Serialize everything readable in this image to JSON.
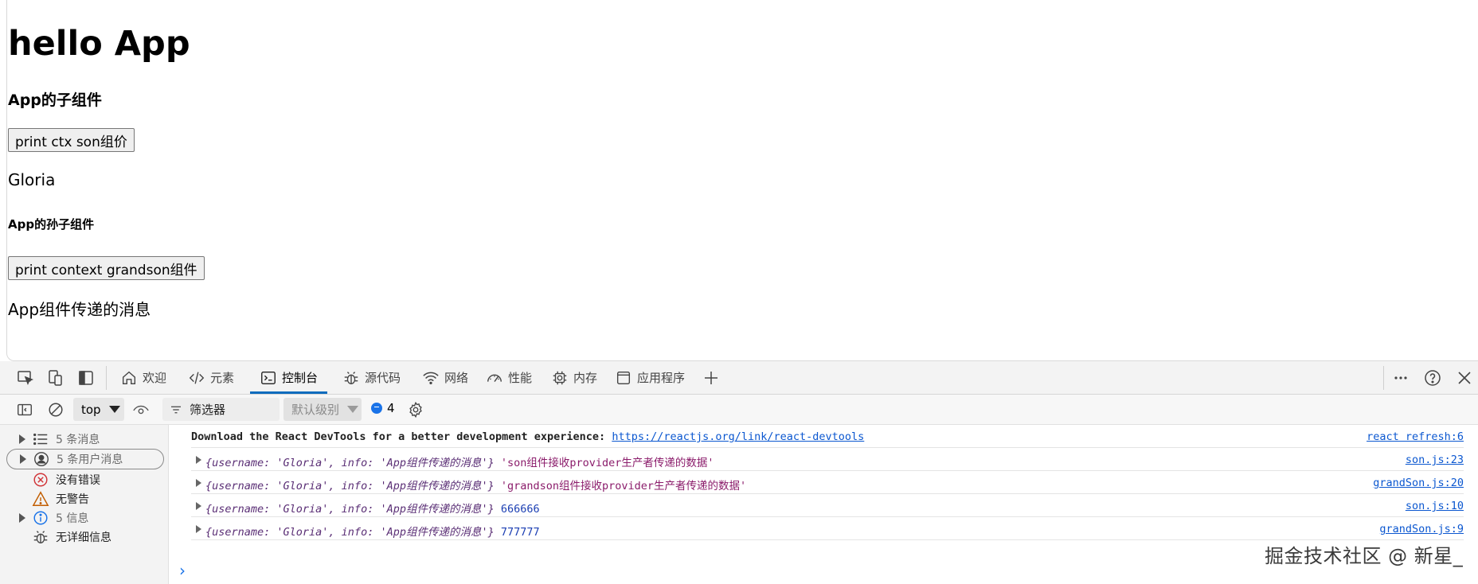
{
  "page": {
    "h1": "hello App",
    "son_title": "App的子组件",
    "son_button": "print ctx son组价",
    "son_value": "Gloria",
    "grandson_title": "App的孙子组件",
    "grandson_button": "print context grandson组件",
    "grandson_value": "App组件传递的消息"
  },
  "devtools": {
    "tabs": [
      {
        "label": "欢迎",
        "icon": "home-icon"
      },
      {
        "label": "元素",
        "icon": "code-icon"
      },
      {
        "label": "控制台",
        "icon": "console-icon",
        "active": true
      },
      {
        "label": "源代码",
        "icon": "bug-icon"
      },
      {
        "label": "网络",
        "icon": "wifi-icon"
      },
      {
        "label": "性能",
        "icon": "gauge-icon"
      },
      {
        "label": "内存",
        "icon": "chip-icon"
      },
      {
        "label": "应用程序",
        "icon": "window-icon"
      }
    ],
    "toolbar": {
      "context": "top",
      "filter_placeholder": "筛选器",
      "levels": "默认级别",
      "issues_count": "4"
    },
    "sidebar": {
      "messages": "5 条消息",
      "user_messages": "5 条用户消息",
      "errors": "没有错误",
      "warnings": "无警告",
      "info": "5 信息",
      "verbose": "无详细信息"
    },
    "console": [
      {
        "prefix": "Download the React DevTools for a better development experience: ",
        "link": "https://reactjs.org/link/react-devtools",
        "source": "react refresh:6"
      },
      {
        "object": "{username: 'Gloria', info: 'App组件传递的消息'}",
        "value": "'son组件接收provider生产者传递的数据'",
        "source": "son.js:23"
      },
      {
        "object": "{username: 'Gloria', info: 'App组件传递的消息'}",
        "value": "'grandson组件接收provider生产者传递的数据'",
        "source": "grandSon.js:20"
      },
      {
        "object": "{username: 'Gloria', info: 'App组件传递的消息'}",
        "value": "666666",
        "source": "son.js:10"
      },
      {
        "object": "{username: 'Gloria', info: 'App组件传递的消息'}",
        "value": "777777",
        "source": "grandSon.js:9"
      }
    ],
    "prompt": "›"
  },
  "watermark": "掘金技术社区 @ 新星_",
  "colors": {
    "accent": "#0f6cbd",
    "link": "#0b57d0",
    "error": "#d13438",
    "warning": "#c25d00",
    "info": "#1a73e8"
  }
}
